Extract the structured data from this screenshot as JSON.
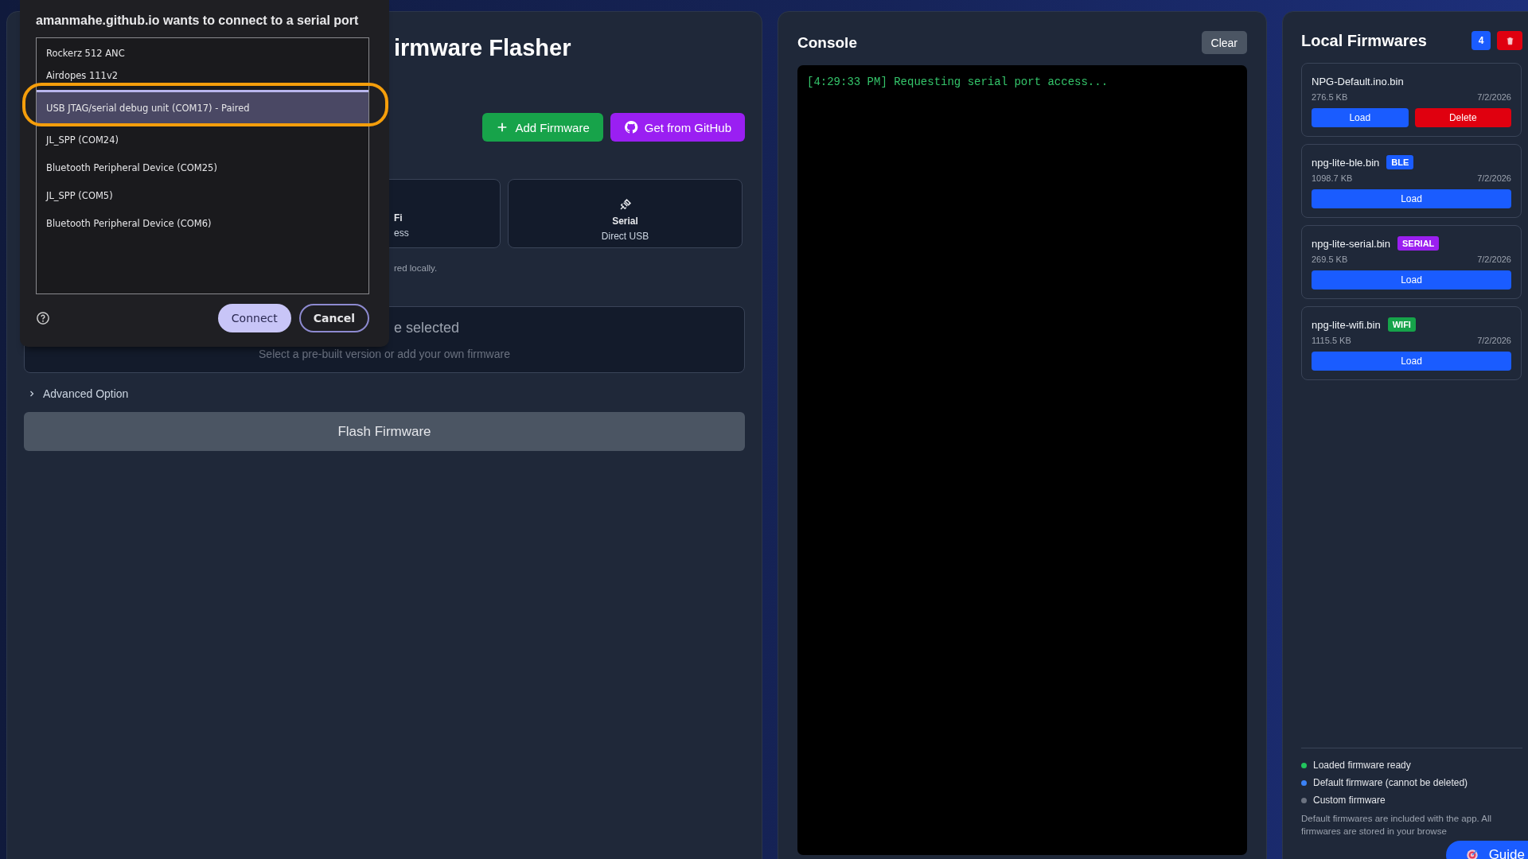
{
  "serial_dialog": {
    "title": "amanmahe.github.io wants to connect to a serial port",
    "devices": [
      {
        "name": "Rockerz 512 ANC",
        "selected": false
      },
      {
        "name": "Airdopes 111v2",
        "selected": false
      },
      {
        "name": "USB JTAG/serial debug unit (COM17) - Paired",
        "selected": true
      },
      {
        "name": "JL_SPP (COM24)",
        "selected": false
      },
      {
        "name": "Bluetooth Peripheral Device (COM25)",
        "selected": false
      },
      {
        "name": "JL_SPP (COM5)",
        "selected": false
      },
      {
        "name": "Bluetooth Peripheral Device (COM6)",
        "selected": false
      }
    ],
    "connect_button": "Connect",
    "cancel_button": "Cancel"
  },
  "flasher": {
    "title": "irmware Flasher",
    "actions": [
      {
        "label": "Add Firmware",
        "kind": "add"
      },
      {
        "label": "Get from GitHub",
        "kind": "github"
      }
    ],
    "modes": [
      {
        "kind": "wifi",
        "title": "Fi",
        "subtitle": "ess"
      },
      {
        "kind": "serial",
        "title": "Serial",
        "subtitle": "Direct USB"
      }
    ],
    "storage_note": "red locally.",
    "status": {
      "title": "e selected",
      "hint": "Select a pre-built version or add your own firmware"
    },
    "advanced": {
      "label": "Advanced Option",
      "expanded": false
    },
    "flash_button": "Flash Firmware"
  },
  "console": {
    "title": "Console",
    "clear_button": "Clear",
    "lines": [
      "[4:29:33 PM] Requesting serial port access..."
    ]
  },
  "local_firmwares": {
    "title": "Local Firmwares",
    "count": "4",
    "items": [
      {
        "name": "NPG-Default.ino.bin",
        "size": "276.5 KB",
        "date": "7/2/2026",
        "actions": [
          "Load",
          "Delete"
        ]
      },
      {
        "name": "npg-lite-ble.bin",
        "tag": "BLE",
        "color": "#1a5cff",
        "size": "1098.7 KB",
        "date": "7/2/2026",
        "actions": [
          "Load"
        ]
      },
      {
        "name": "npg-lite-serial.bin",
        "tag": "SERIAL",
        "color": "#9b1ff0",
        "size": "269.5 KB",
        "date": "7/2/2026",
        "actions": [
          "Load"
        ]
      },
      {
        "name": "npg-lite-wifi.bin",
        "tag": "WIFI",
        "color": "#16a34a",
        "size": "1115.5 KB",
        "date": "7/2/2026",
        "actions": [
          "Load"
        ]
      }
    ],
    "legend": [
      {
        "label": "Loaded firmware ready",
        "color": "#22c55e"
      },
      {
        "label": "Default firmware (cannot be deleted)",
        "color": "#3b82f6"
      },
      {
        "label": "Custom firmware",
        "color": "#6b7280"
      }
    ],
    "note": "Default firmwares are included with the app. All firmwares are stored in your browse",
    "guide_button": "Guide"
  }
}
